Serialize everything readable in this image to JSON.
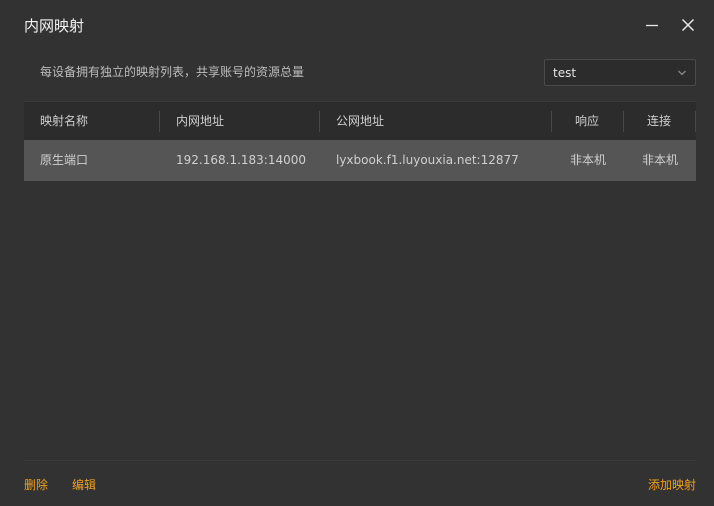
{
  "window": {
    "title": "内网映射"
  },
  "header": {
    "description": "每设备拥有独立的映射列表，共享账号的资源总量",
    "device_select": {
      "value": "test"
    }
  },
  "table": {
    "columns": [
      "映射名称",
      "内网地址",
      "公网地址",
      "响应",
      "连接"
    ],
    "rows": [
      {
        "name": "原生端口",
        "internal": "192.168.1.183:14000",
        "public": "lyxbook.f1.luyouxia.net:12877",
        "response": "非本机",
        "connection": "非本机"
      }
    ]
  },
  "footer": {
    "delete_label": "删除",
    "edit_label": "编辑",
    "add_label": "添加映射"
  },
  "colors": {
    "background": "#323232",
    "header_row": "#2c2c2c",
    "selected_row": "#555555",
    "accent": "#f0a020"
  }
}
